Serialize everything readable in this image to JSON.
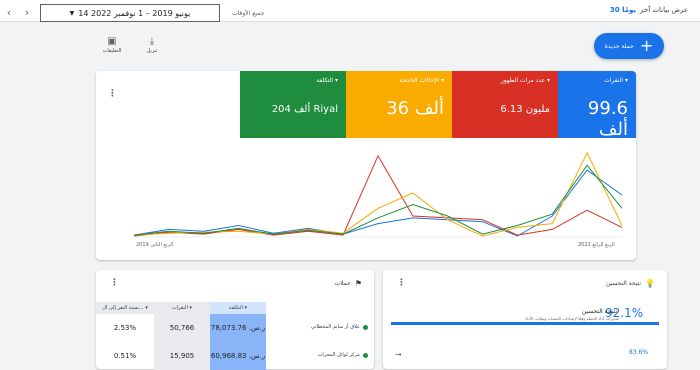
{
  "topbar": {
    "show_last": "عرض بيانات آخر",
    "days": "30 يومًا",
    "date_range": "14 يونيو 2019 – 1 نوفمبر 2022",
    "range_label": "جميع الأوقات",
    "prev_icon": "chevron-left-icon",
    "next_icon": "chevron-right-icon"
  },
  "toolbar": {
    "new_campaign": "حملة جديدة",
    "download": "تنزيل",
    "comments": "التعليقات"
  },
  "kpis": [
    {
      "label": "النقرات",
      "value": "99.6 ألف",
      "color": "#1a73e8"
    },
    {
      "label": "عدد مرات الظهور",
      "value": "6.13 مليون",
      "color": "#d93025"
    },
    {
      "label": "الإحالات الناجحة",
      "value": "36 ألف",
      "color": "#f9ab00"
    },
    {
      "label": "التكلفة",
      "value": "204 ألف Riyal",
      "color": "#1e8e3e"
    }
  ],
  "chart_data": {
    "type": "line",
    "x_start": "الربع الثاني 2019",
    "x_end": "الربع الرابع 2022",
    "series": [
      {
        "name": "النقرات",
        "color": "#1a73e8",
        "values": [
          2,
          8,
          6,
          12,
          4,
          9,
          3,
          14,
          20,
          18,
          16,
          1,
          22,
          70,
          44
        ]
      },
      {
        "name": "عدد مرات الظهور",
        "color": "#d93025",
        "values": [
          1,
          5,
          3,
          8,
          2,
          6,
          2,
          85,
          22,
          20,
          18,
          2,
          8,
          28,
          10
        ]
      },
      {
        "name": "الإحالات الناجحة",
        "color": "#f9ab00",
        "values": [
          2,
          4,
          5,
          6,
          3,
          8,
          4,
          30,
          46,
          18,
          1,
          10,
          14,
          88,
          12
        ]
      },
      {
        "name": "التكلفة",
        "color": "#1e8e3e",
        "values": [
          2,
          6,
          4,
          9,
          3,
          7,
          3,
          20,
          34,
          22,
          3,
          12,
          24,
          75,
          30
        ]
      }
    ]
  },
  "campaigns": {
    "title": "حملات",
    "headers": {
      "cost": "التكلفة",
      "clicks": "النقرات",
      "ctr": "نسبة النقر إلى ال..."
    },
    "rows": [
      {
        "name": "علاق أز سايم المحطاتي",
        "cost": "ر.س. 78,073.76",
        "clicks": "50,766",
        "ctr": "2.53%"
      },
      {
        "name": "مركز لوائل المجرات",
        "cost": "ر.س. 60,968.83",
        "clicks": "15,905",
        "ctr": "0.51%"
      }
    ]
  },
  "optimization": {
    "title": "نتيجة التحسين",
    "score": "92.1%",
    "card_title": "نتيجة التحسين",
    "desc": "تقديرات أداء الحملة وفقًا لإعدادات الحساب وبيانات الأداء",
    "sub_pct": "83.6%"
  }
}
